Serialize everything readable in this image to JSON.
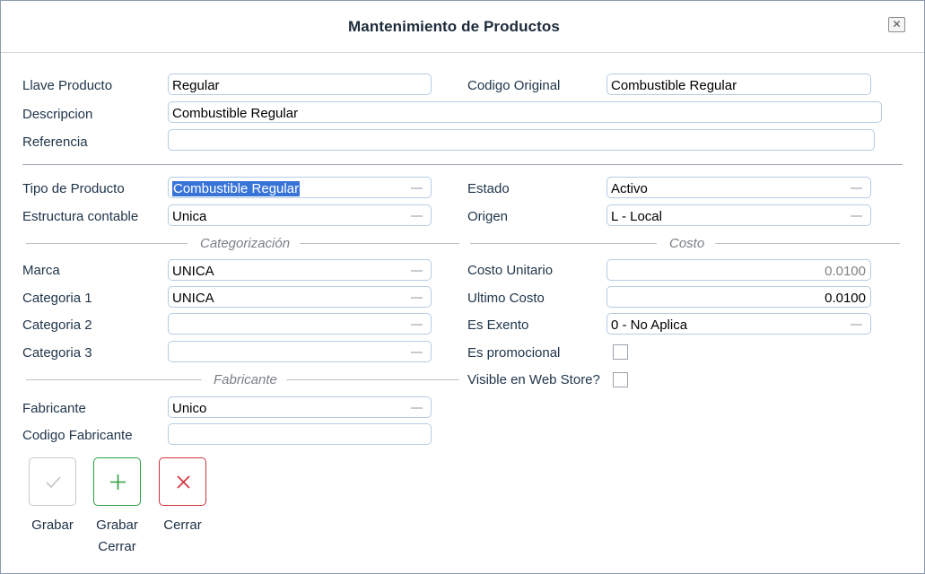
{
  "dialog": {
    "title": "Mantenimiento de Productos"
  },
  "fields": {
    "llave_producto": {
      "label": "Llave Producto",
      "value": "Regular"
    },
    "codigo_original": {
      "label": "Codigo Original",
      "value": "Combustible Regular"
    },
    "descripcion": {
      "label": "Descripcion",
      "value": "Combustible Regular"
    },
    "referencia": {
      "label": "Referencia",
      "value": ""
    },
    "tipo_producto": {
      "label": "Tipo de Producto",
      "value": "Combustible Regular"
    },
    "estado": {
      "label": "Estado",
      "value": "Activo"
    },
    "estructura_contable": {
      "label": "Estructura contable",
      "value": "Unica"
    },
    "origen": {
      "label": "Origen",
      "value": "L - Local"
    },
    "marca": {
      "label": "Marca",
      "value": "UNICA"
    },
    "categoria_1": {
      "label": "Categoria 1",
      "value": "UNICA"
    },
    "categoria_2": {
      "label": "Categoria 2",
      "value": ""
    },
    "categoria_3": {
      "label": "Categoria 3",
      "value": ""
    },
    "costo_unitario": {
      "label": "Costo Unitario",
      "value": "0.0100"
    },
    "ultimo_costo": {
      "label": "Ultimo Costo",
      "value": "0.0100"
    },
    "es_exento": {
      "label": "Es Exento",
      "value": "0 - No Aplica"
    },
    "es_promocional": {
      "label": "Es promocional",
      "checked": false
    },
    "visible_web_store": {
      "label": "Visible en Web Store?",
      "checked": false
    },
    "fabricante": {
      "label": "Fabricante",
      "value": "Unico"
    },
    "codigo_fabricante": {
      "label": "Codigo Fabricante",
      "value": ""
    }
  },
  "sections": {
    "categorizacion": "Categorización",
    "costo": "Costo",
    "fabricante": "Fabricante"
  },
  "buttons": {
    "grabar": {
      "label": "Grabar",
      "icon": "check-icon",
      "color": "#c8c8c8"
    },
    "grabar_cerrar": {
      "label_line1": "Grabar",
      "label_line2": "Cerrar",
      "icon": "plus-icon",
      "color": "#2e9e3e"
    },
    "cerrar": {
      "label": "Cerrar",
      "icon": "x-icon",
      "color": "#d0313a"
    }
  }
}
